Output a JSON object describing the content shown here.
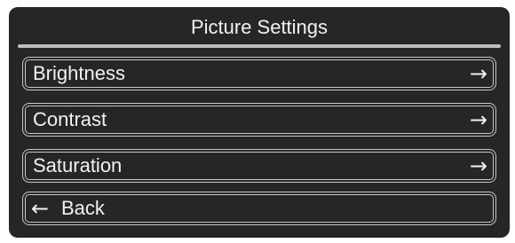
{
  "header": {
    "title": "Picture Settings"
  },
  "menu": {
    "items": [
      {
        "label": "Brightness",
        "icon": "arrow-right-icon",
        "glyph": "→"
      },
      {
        "label": "Contrast",
        "icon": "arrow-right-icon",
        "glyph": "→"
      },
      {
        "label": "Saturation",
        "icon": "arrow-right-icon",
        "glyph": "→"
      }
    ],
    "back": {
      "label": "Back",
      "icon": "arrow-left-icon",
      "glyph": "←"
    }
  },
  "colors": {
    "background": "#262626",
    "text": "#f2f2f2",
    "border": "#c8c8c8",
    "divider": "#bdbdbd"
  }
}
